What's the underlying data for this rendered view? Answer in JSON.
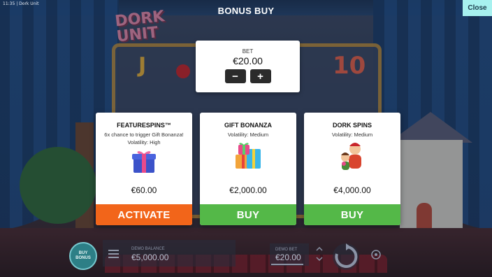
{
  "status_bar": {
    "time": "11:35",
    "app": "Dork Unit"
  },
  "header": {
    "title": "BONUS BUY",
    "close_label": "Close"
  },
  "bet_panel": {
    "label": "BET",
    "value": "€20.00",
    "decrease_label": "−",
    "increase_label": "+"
  },
  "cards": [
    {
      "title": "FEATURESPINS™",
      "desc_line1": "6x chance to trigger Gift Bonanza!",
      "desc_line2": "Volatility: High",
      "icon": "gift-box-icon",
      "price": "€60.00",
      "button_label": "ACTIVATE"
    },
    {
      "title": "GIFT BONANZA",
      "desc_line1": "Volatility: Medium",
      "icon": "gift-stack-icon",
      "price": "€2,000.00",
      "button_label": "BUY"
    },
    {
      "title": "DORK SPINS",
      "desc_line1": "Volatility: Medium",
      "icon": "dork-characters-icon",
      "price": "€4,000.00",
      "button_label": "BUY"
    }
  ],
  "bottom_bar": {
    "buy_bonus_line1": "BUY",
    "buy_bonus_line2": "BONUS",
    "balance_label": "DEMO BALANCE",
    "balance_value": "€5,000.00",
    "bet_label": "DEMO BET",
    "bet_value": "€20.00"
  },
  "colors": {
    "close_bg": "#a7f1ef",
    "activate_bg": "#f2651a",
    "buy_bg": "#54b848"
  }
}
